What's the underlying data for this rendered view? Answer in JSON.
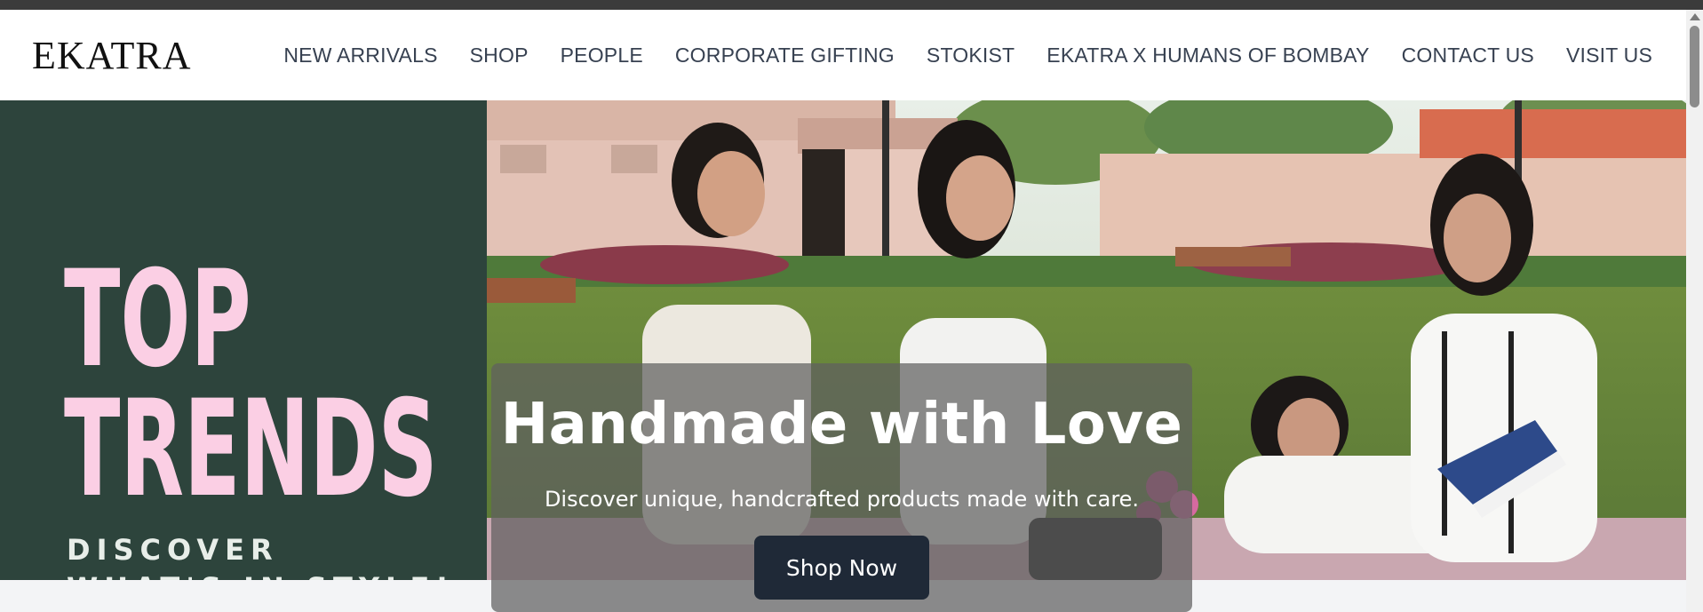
{
  "brand": {
    "logo_text": "EKATRA"
  },
  "nav": {
    "items": [
      {
        "label": "NEW ARRIVALS"
      },
      {
        "label": "SHOP"
      },
      {
        "label": "PEOPLE"
      },
      {
        "label": "CORPORATE GIFTING"
      },
      {
        "label": "STOKIST"
      },
      {
        "label": "EKATRA X HUMANS OF BOMBAY"
      },
      {
        "label": "CONTACT US"
      },
      {
        "label": "VISIT US"
      }
    ]
  },
  "promo": {
    "line1": "TOP",
    "line2": "TRENDS",
    "sub1": "DISCOVER",
    "sub2": "WHAT'S IN STYLE!"
  },
  "hero": {
    "title": "Handmade with Love",
    "subtitle": "Discover unique, handcrafted products made with care.",
    "cta_label": "Shop Now"
  },
  "colors": {
    "promo_bg": "#2d443c",
    "promo_text": "#fbcfe4",
    "button_bg": "#1f2937",
    "nav_text": "#374151"
  }
}
